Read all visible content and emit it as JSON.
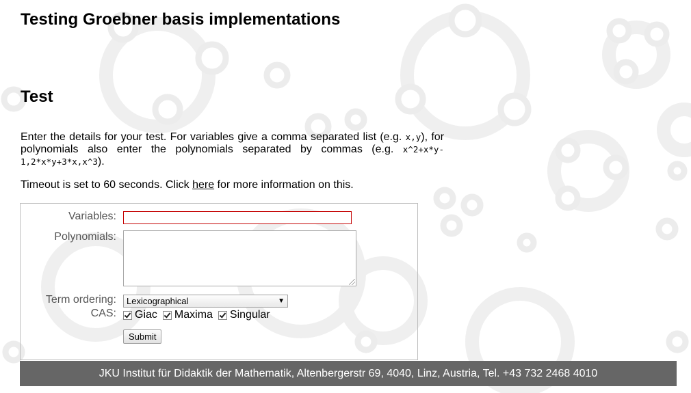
{
  "page": {
    "title": "Testing Groebner basis implementations",
    "section_heading": "Test",
    "intro": {
      "part1": "Enter the details for your test. For variables give a comma separated list (e.g. ",
      "example_vars": "x,y",
      "part2": "), for polynomials also enter the polynomials separated by commas (e.g. ",
      "example_polys": "x^2+x*y-1,2*x*y+3*x,x^3",
      "part3": ")."
    },
    "timeout": {
      "before": "Timeout is set to 60 seconds. Click ",
      "link": "here",
      "after": " for more information on this."
    }
  },
  "form": {
    "variables_label": "Variables:",
    "variables_value": "",
    "polynomials_label": "Polynomials:",
    "polynomials_value": "",
    "term_ordering_label": "Term ordering:",
    "term_ordering_selected": "Lexicographical",
    "cas_label": "CAS:",
    "cas_options": [
      {
        "label": "Giac",
        "checked": true
      },
      {
        "label": "Maxima",
        "checked": true
      },
      {
        "label": "Singular",
        "checked": true
      }
    ],
    "submit_label": "Submit"
  },
  "footer": {
    "text": "JKU Institut für Didaktik der Mathematik, Altenbergerstr 69, 4040, Linz, Austria, Tel. +43 732 2468 4010"
  },
  "colors": {
    "footer_bg": "#666666",
    "invalid_border": "#c40000",
    "bg_pattern": "#ebebeb"
  }
}
